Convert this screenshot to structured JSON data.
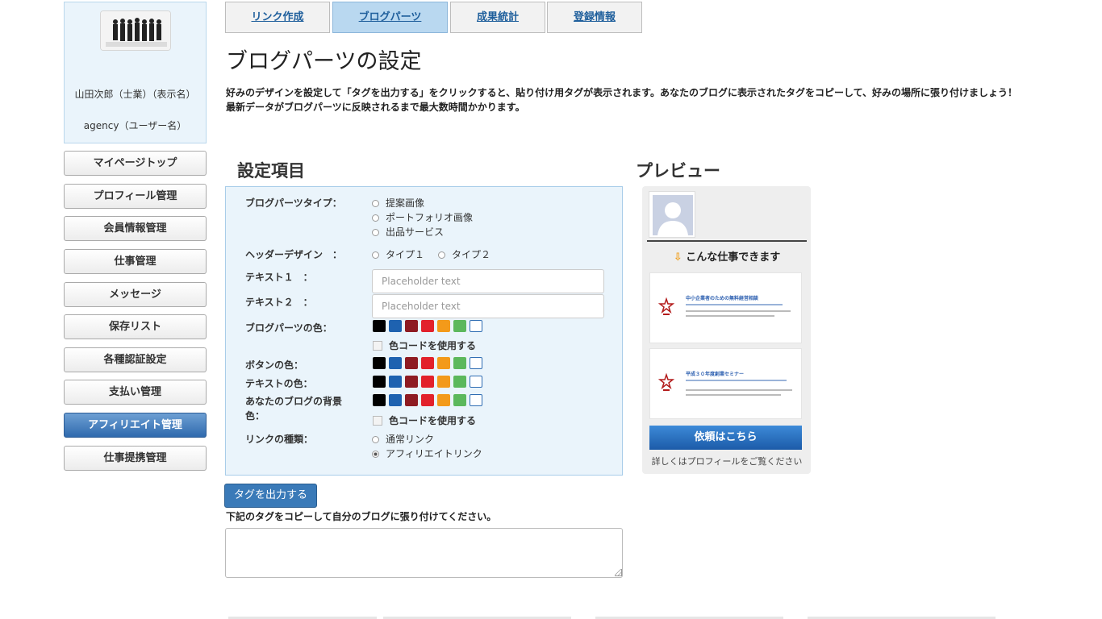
{
  "profile": {
    "display_name": "山田次郎（士業）（表示名）",
    "user_id": "agency（ユーザー名）"
  },
  "sidebar": {
    "items": [
      {
        "label": "マイページトップ"
      },
      {
        "label": "プロフィール管理"
      },
      {
        "label": "会員情報管理"
      },
      {
        "label": "仕事管理"
      },
      {
        "label": "メッセージ"
      },
      {
        "label": "保存リスト"
      },
      {
        "label": "各種認証設定"
      },
      {
        "label": "支払い管理"
      },
      {
        "label": "アフィリエイト管理",
        "active": true
      },
      {
        "label": "仕事提携管理"
      }
    ]
  },
  "tabs": [
    {
      "label": "リンク作成"
    },
    {
      "label": "ブログパーツ",
      "active": true
    },
    {
      "label": "成果統計"
    },
    {
      "label": "登録情報"
    }
  ],
  "page": {
    "title": "ブログパーツの設定",
    "intro": "好みのデザインを設定して「タグを出力する」をクリックすると、貼り付け用タグが表示されます。あなたのブログに表示されたタグをコピーして、好みの場所に張り付けましょう！最新データがブログパーツに反映されるまで最大数時間かかります。"
  },
  "settings": {
    "heading": "設定項目",
    "blogparts_type": {
      "label": "ブログパーツタイプ：",
      "options": [
        "提案画像",
        "ポートフォリオ画像",
        "出品サービス"
      ]
    },
    "header_design": {
      "label": "ヘッダーデザイン　：",
      "options": [
        "タイプ１",
        "タイプ２"
      ]
    },
    "text1": {
      "label": "テキスト１　：",
      "placeholder": "Placeholder text"
    },
    "text2": {
      "label": "テキスト２　：",
      "placeholder": "Placeholder text"
    },
    "parts_color_label": "ブログパーツの色：",
    "use_color_code": "色コードを使用する",
    "button_color_label": "ボタンの色：",
    "text_color_label": "テキストの色：",
    "bg_color_label": "あなたのブログの背景色：",
    "link_type": {
      "label": "リンクの種類：",
      "options": [
        "通常リンク",
        "アフィリエイトリンク"
      ],
      "selected": "アフィリエイトリンク"
    },
    "swatch_colors": [
      "#000000",
      "#1e62b0",
      "#8e1b22",
      "#e2212b",
      "#f39a1a",
      "#5cb85c",
      "#ffffff"
    ]
  },
  "output": {
    "button_label": "タグを出力する",
    "note": "下記のタグをコピーして自分のブログに張り付けてください。"
  },
  "preview": {
    "heading": "プレビュー",
    "header_text": "こんな仕事できます",
    "cards": [
      {
        "title": "中小企業者のための無料経営相談"
      },
      {
        "title": "平成３０年度創業セミナー"
      }
    ],
    "button_label": "依頼はこちら",
    "footer": "詳しくはプロフィールをご覧ください"
  }
}
